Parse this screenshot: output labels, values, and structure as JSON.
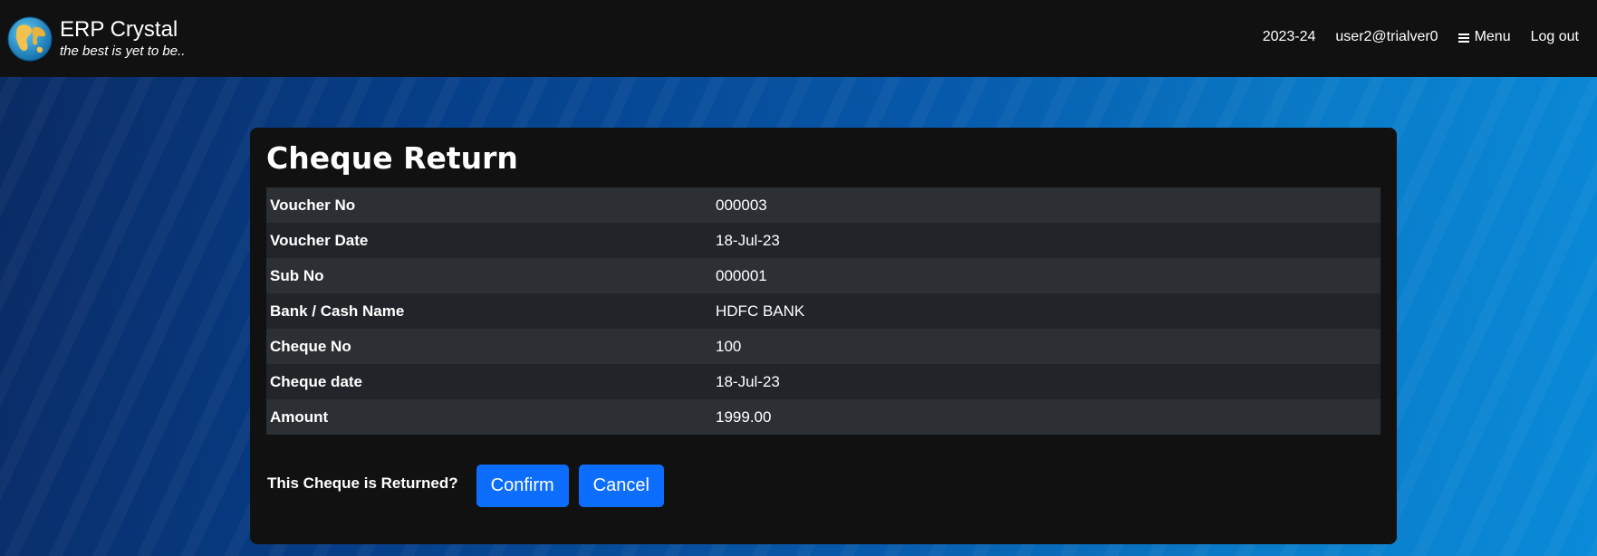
{
  "header": {
    "brand_title": "ERP Crystal",
    "brand_tagline": "the best is yet to be..",
    "year": "2023-24",
    "user": "user2@trialver0",
    "menu_label": "Menu",
    "logout_label": "Log out"
  },
  "card": {
    "title": "Cheque Return",
    "rows": [
      {
        "label": "Voucher No",
        "value": "000003"
      },
      {
        "label": "Voucher Date",
        "value": "18-Jul-23"
      },
      {
        "label": "Sub No",
        "value": "000001"
      },
      {
        "label": "Bank / Cash Name",
        "value": "HDFC BANK"
      },
      {
        "label": "Cheque No",
        "value": "100"
      },
      {
        "label": "Cheque date",
        "value": "18-Jul-23"
      },
      {
        "label": "Amount",
        "value": "1999.00"
      }
    ],
    "question": "This Cheque is Returned?",
    "confirm_label": "Confirm",
    "cancel_label": "Cancel"
  },
  "icons": {
    "logo": "globe-icon",
    "menu": "hamburger-icon"
  },
  "colors": {
    "navbar": "#111111",
    "card": "#111111",
    "primary_button": "#0d6efd",
    "row_odd": "#2c3035",
    "row_even": "#212429"
  }
}
